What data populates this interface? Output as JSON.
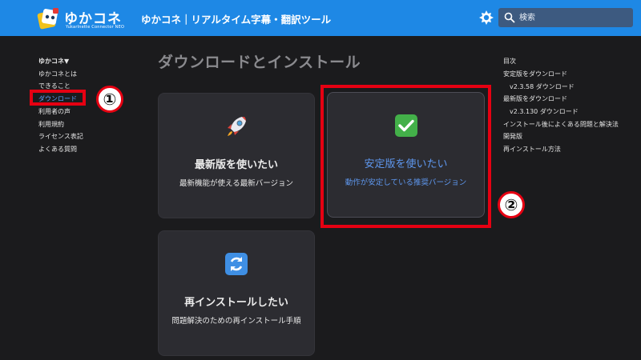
{
  "header": {
    "brand": "ゆかコネ",
    "brand_sub": "YukarInette Connector NEO",
    "site_title": "ゆかコネ｜リアルタイム字幕・翻訳ツール",
    "search_placeholder": "検索",
    "accent_color": "#1e88e5"
  },
  "sidebar": {
    "items": [
      {
        "label": "ゆかコネ▼"
      },
      {
        "label": "ゆかコネとは"
      },
      {
        "label": "できること"
      },
      {
        "label": "ダウンロード"
      },
      {
        "label": "利用者の声"
      },
      {
        "label": "利用規約"
      },
      {
        "label": "ライセンス表記"
      },
      {
        "label": "よくある質問"
      }
    ]
  },
  "callouts": {
    "one": "①",
    "two": "②"
  },
  "main": {
    "heading": "ダウンロードとインストール",
    "cards": [
      {
        "icon": "rocket-icon",
        "title": "最新版を使いたい",
        "desc": "最新機能が使える最新バージョン"
      },
      {
        "icon": "checkmark-icon",
        "title": "安定版を使いたい",
        "desc": "動作が安定している推奨バージョン"
      },
      {
        "icon": "refresh-icon",
        "title": "再インストールしたい",
        "desc": "問題解決のための再インストール手順"
      }
    ]
  },
  "toc": {
    "items": [
      {
        "label": "目次"
      },
      {
        "label": "安定版をダウンロード"
      },
      {
        "label": "v2.3.58 ダウンロード"
      },
      {
        "label": "最新版をダウンロード"
      },
      {
        "label": "v2.3.130 ダウンロード"
      },
      {
        "label": "インストール後によくある問題と解決法"
      },
      {
        "label": "開発版"
      },
      {
        "label": "再インストール方法"
      }
    ]
  }
}
